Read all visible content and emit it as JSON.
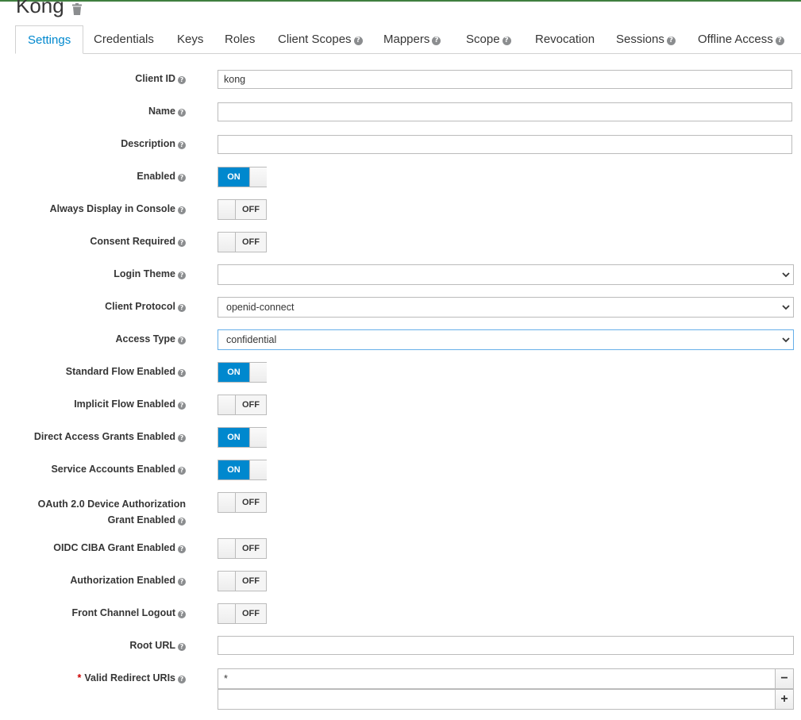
{
  "client": {
    "title": "Kong"
  },
  "tabs": [
    {
      "label": "Settings",
      "help": false
    },
    {
      "label": "Credentials",
      "help": false
    },
    {
      "label": "Keys",
      "help": false
    },
    {
      "label": "Roles",
      "help": false
    },
    {
      "label": "Client Scopes",
      "help": true
    },
    {
      "label": "Mappers",
      "help": true
    },
    {
      "label": "Scope",
      "help": true
    },
    {
      "label": "Revocation",
      "help": false
    },
    {
      "label": "Sessions",
      "help": true
    },
    {
      "label": "Offline Access",
      "help": true
    }
  ],
  "fields": {
    "client_id": {
      "label": "Client ID",
      "value": "kong"
    },
    "name": {
      "label": "Name",
      "value": ""
    },
    "description": {
      "label": "Description",
      "value": ""
    },
    "enabled": {
      "label": "Enabled",
      "state": "ON"
    },
    "always_display": {
      "label": "Always Display in Console",
      "state": "OFF"
    },
    "consent_required": {
      "label": "Consent Required",
      "state": "OFF"
    },
    "login_theme": {
      "label": "Login Theme",
      "value": ""
    },
    "client_protocol": {
      "label": "Client Protocol",
      "value": "openid-connect"
    },
    "access_type": {
      "label": "Access Type",
      "value": "confidential"
    },
    "standard_flow": {
      "label": "Standard Flow Enabled",
      "state": "ON"
    },
    "implicit_flow": {
      "label": "Implicit Flow Enabled",
      "state": "OFF"
    },
    "direct_access": {
      "label": "Direct Access Grants Enabled",
      "state": "ON"
    },
    "service_accounts": {
      "label": "Service Accounts Enabled",
      "state": "ON"
    },
    "device_auth": {
      "label_line1": "OAuth 2.0 Device Authorization",
      "label_line2": "Grant Enabled",
      "state": "OFF"
    },
    "ciba": {
      "label": "OIDC CIBA Grant Enabled",
      "state": "OFF"
    },
    "authorization": {
      "label": "Authorization Enabled",
      "state": "OFF"
    },
    "front_channel": {
      "label": "Front Channel Logout",
      "state": "OFF"
    },
    "root_url": {
      "label": "Root URL",
      "value": ""
    },
    "redirect_uris": {
      "label": "Valid Redirect URIs",
      "required_mark": "*",
      "values": [
        "*",
        ""
      ],
      "remove_symbol": "−",
      "add_symbol": "+"
    }
  },
  "help_glyph": "?",
  "colors": {
    "accent": "#0088ce",
    "required": "#cc0000"
  },
  "icons": {
    "delete": "trash-icon",
    "help": "question-circle-icon",
    "select": "chevron-down-icon"
  }
}
